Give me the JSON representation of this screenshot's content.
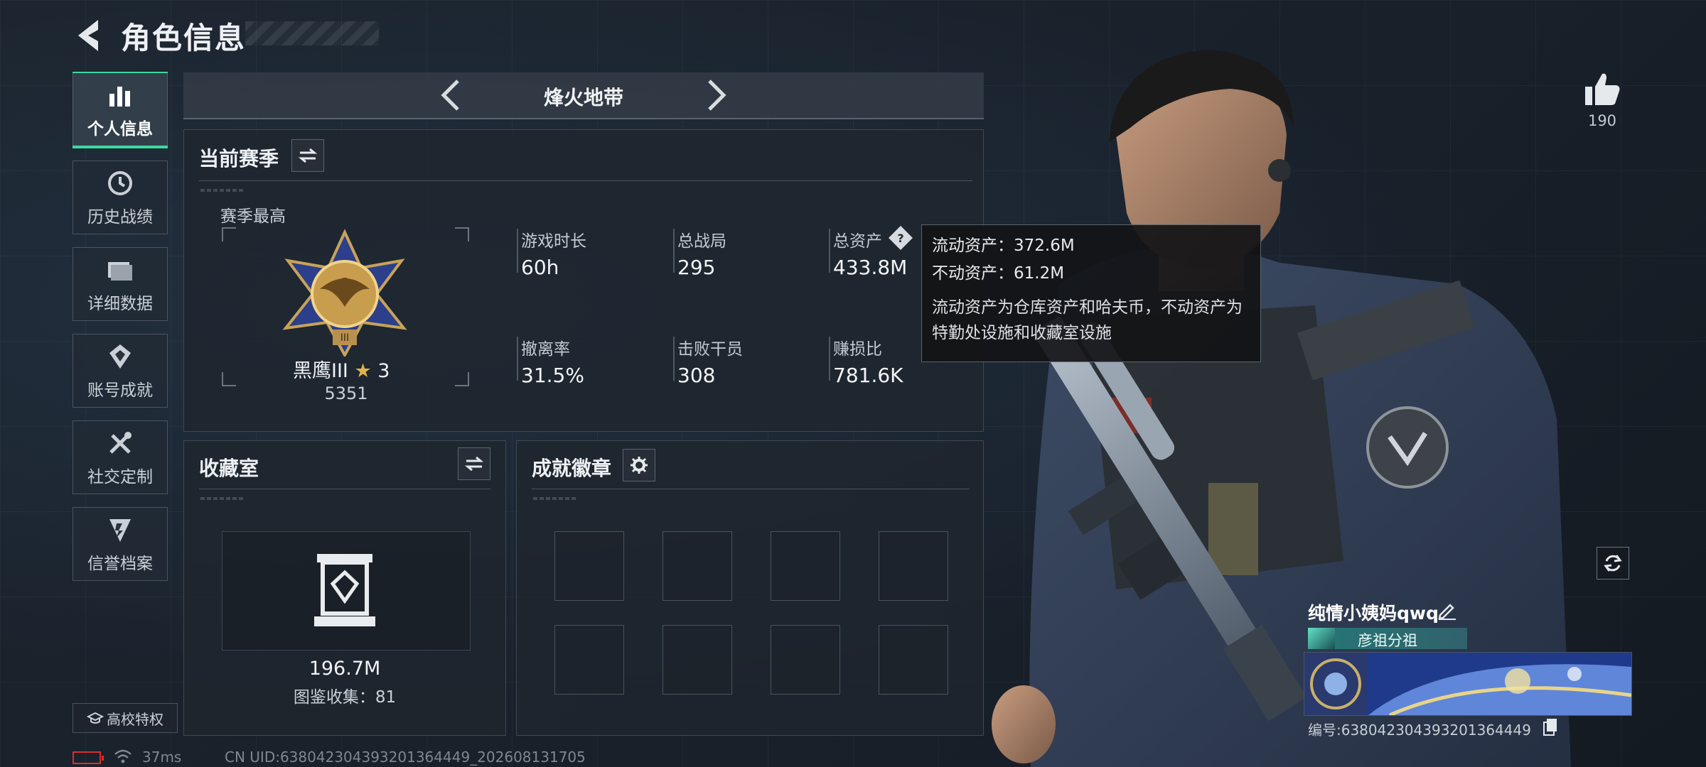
{
  "header": {
    "title": "角色信息"
  },
  "sidebar": {
    "items": [
      {
        "label": "个人信息",
        "icon": "bar-chart-icon",
        "active": true
      },
      {
        "label": "历史战绩",
        "icon": "history-icon"
      },
      {
        "label": "详细数据",
        "icon": "folder-icon"
      },
      {
        "label": "账号成就",
        "icon": "achievement-icon"
      },
      {
        "label": "社交定制",
        "icon": "tools-icon"
      },
      {
        "label": "信誉档案",
        "icon": "shield-icon"
      }
    ],
    "campus_button": "高校特权"
  },
  "mode_bar": {
    "name": "烽火地带"
  },
  "season": {
    "title": "当前赛季",
    "best_label": "赛季最高",
    "rank_name": "黑鹰III",
    "rank_stars": "3",
    "rank_score": "5351",
    "stats": [
      {
        "label": "游戏时长",
        "value": "60h"
      },
      {
        "label": "总战局",
        "value": "295"
      },
      {
        "label": "总资产",
        "value": "433.8M"
      },
      {
        "label": "撤离率",
        "value": "31.5%"
      },
      {
        "label": "击败干员",
        "value": "308"
      },
      {
        "label": "赚损比",
        "value": "781.6K"
      }
    ]
  },
  "tooltip": {
    "line1": "流动资产：372.6M",
    "line2": "不动资产：61.2M",
    "description": "流动资产为仓库资产和哈夫币，不动资产为特勤处设施和收藏室设施"
  },
  "collection": {
    "title": "收藏室",
    "value": "196.7M",
    "count_label": "图鉴收集：81"
  },
  "achievements": {
    "title": "成就徽章"
  },
  "profile": {
    "likes": "190",
    "nickname": "纯情小姨妈qwq",
    "guild": "彦祖分祖",
    "uid_label": "编号:638042304393201364449"
  },
  "footer": {
    "ping": "37ms",
    "uid_line": "CN UID:638042304393201364449_202608131705"
  },
  "colors": {
    "accent": "#3fd7a0",
    "panel": "#1f262e",
    "background": "#1a2129",
    "alert": "#d92e2e"
  }
}
